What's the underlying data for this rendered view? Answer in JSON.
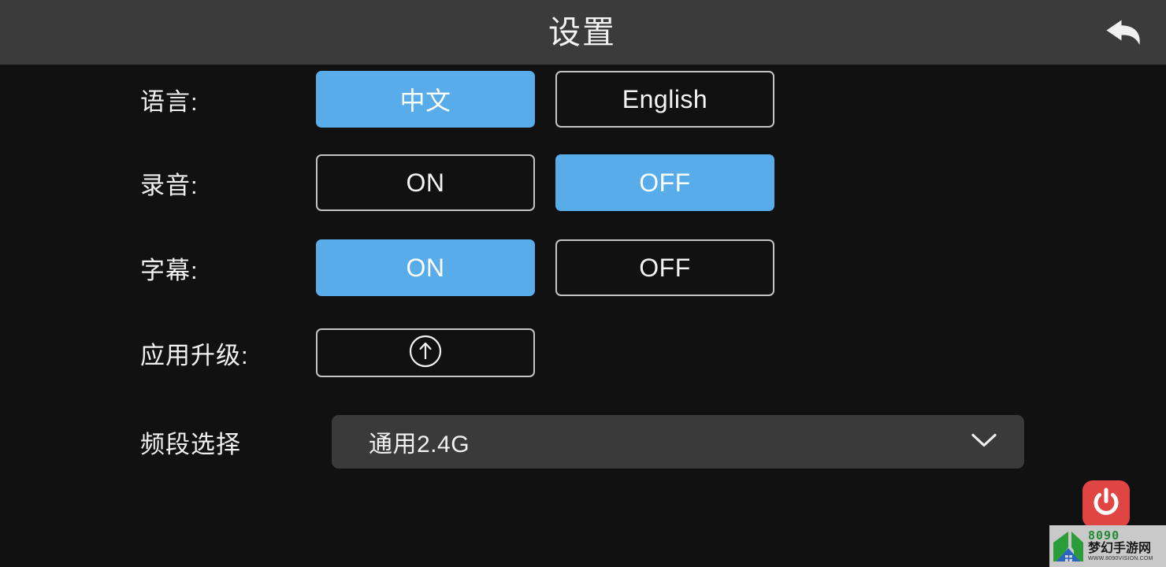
{
  "header": {
    "title": "设置",
    "back_icon": "back-arrow-icon"
  },
  "rows": [
    {
      "label": "语言:",
      "type": "toggle-pair",
      "options": [
        {
          "label": "中文",
          "selected": true
        },
        {
          "label": "English",
          "selected": false
        }
      ]
    },
    {
      "label": "录音:",
      "type": "toggle-pair",
      "options": [
        {
          "label": "ON",
          "selected": false
        },
        {
          "label": "OFF",
          "selected": true
        }
      ]
    },
    {
      "label": "字幕:",
      "type": "toggle-pair",
      "options": [
        {
          "label": "ON",
          "selected": true
        },
        {
          "label": "OFF",
          "selected": false
        }
      ]
    },
    {
      "label": "应用升级:",
      "type": "button",
      "icon": "upload-circle-arrow-icon"
    },
    {
      "label": "频段选择",
      "type": "dropdown",
      "value": "通用2.4G",
      "icon": "chevron-down-icon"
    }
  ],
  "power_button": {
    "icon": "power-icon",
    "color": "#e04544"
  },
  "watermark": {
    "brand": "8090",
    "name": "梦幻手游网",
    "url": "WWW.8090VISION.COM"
  },
  "colors": {
    "accent": "#57ace9",
    "header_bg": "#3b3b3b",
    "page_bg": "#111111",
    "dropdown_bg": "#3a3a3a",
    "border": "#c4c4c4",
    "power_red": "#e04544"
  }
}
